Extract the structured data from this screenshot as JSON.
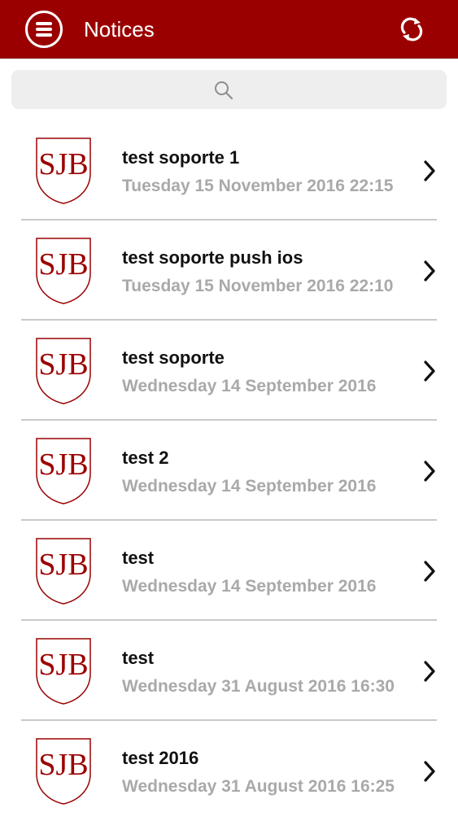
{
  "header": {
    "title": "Notices",
    "menu_icon": "menu-icon",
    "refresh_icon": "refresh-icon",
    "bg_color": "#9b0000"
  },
  "search": {
    "placeholder": "",
    "value": "",
    "icon": "search-icon"
  },
  "notices": [
    {
      "title": "test soporte 1",
      "date": "Tuesday 15 November 2016 22:15"
    },
    {
      "title": "test soporte push ios",
      "date": "Tuesday 15 November 2016 22:10"
    },
    {
      "title": "test soporte",
      "date": "Wednesday 14 September 2016"
    },
    {
      "title": "test 2",
      "date": "Wednesday 14 September 2016"
    },
    {
      "title": "test",
      "date": "Wednesday 14 September 2016"
    },
    {
      "title": "test",
      "date": "Wednesday 31 August 2016 16:30"
    },
    {
      "title": "test 2016",
      "date": "Wednesday 31 August 2016 16:25"
    }
  ],
  "logo": {
    "text": "SJB",
    "color": "#9b0000"
  }
}
